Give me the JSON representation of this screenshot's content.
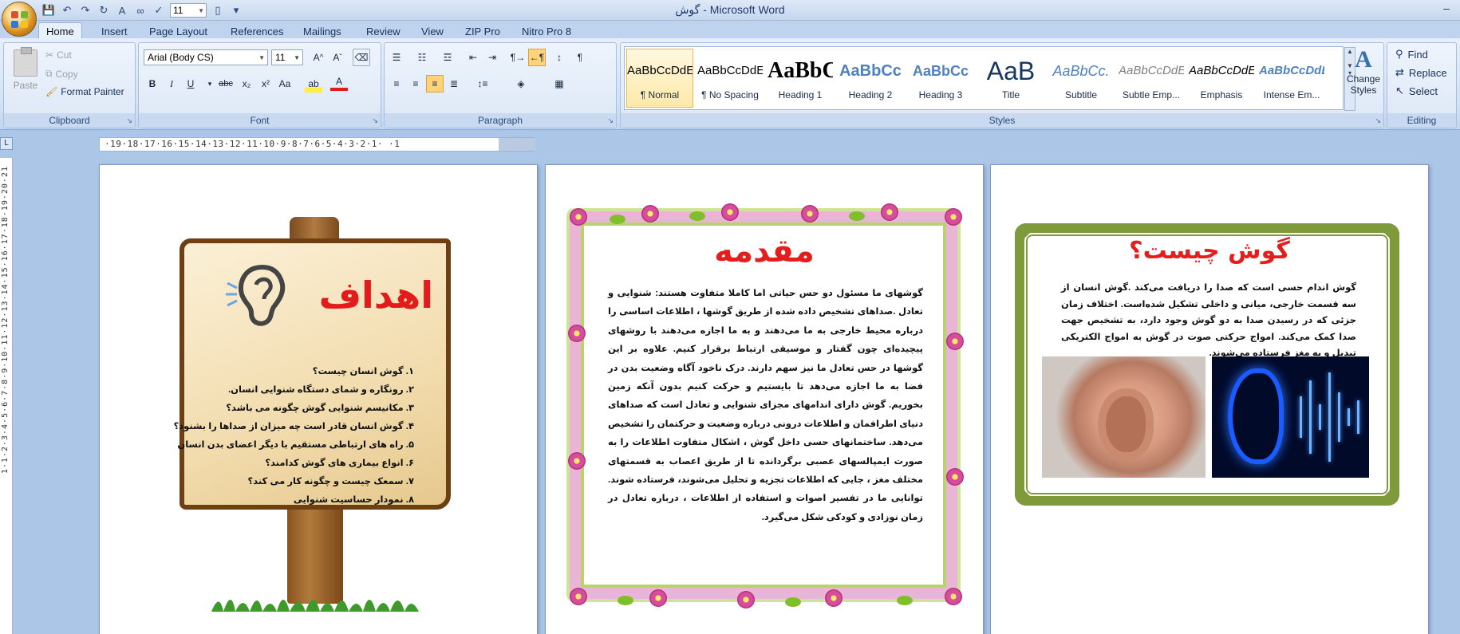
{
  "window": {
    "title": "گوش - Microsoft Word",
    "qat_font_size": "11"
  },
  "tabs": [
    "Home",
    "Insert",
    "Page Layout",
    "References",
    "Mailings",
    "Review",
    "View",
    "ZIP Pro",
    "Nitro Pro 8"
  ],
  "clipboard": {
    "label": "Clipboard",
    "paste": "Paste",
    "cut": "Cut",
    "copy": "Copy",
    "format_painter": "Format Painter"
  },
  "font": {
    "label": "Font",
    "name": "Arial (Body CS)",
    "size": "11"
  },
  "paragraph": {
    "label": "Paragraph"
  },
  "styles": {
    "label": "Styles",
    "items": [
      {
        "preview": "AaBbCcDdEe",
        "name": "¶ Normal"
      },
      {
        "preview": "AaBbCcDdEe",
        "name": "¶ No Spacing"
      },
      {
        "preview": "AaBbCc",
        "name": "Heading 1"
      },
      {
        "preview": "AaBbCc",
        "name": "Heading 2"
      },
      {
        "preview": "AaBbCc",
        "name": "Heading 3"
      },
      {
        "preview": "AaB",
        "name": "Title"
      },
      {
        "preview": "AaBbCc.",
        "name": "Subtitle"
      },
      {
        "preview": "AaBbCcDdEe",
        "name": "Subtle Emp..."
      },
      {
        "preview": "AaBbCcDdEe",
        "name": "Emphasis"
      },
      {
        "preview": "AaBbCcDdEe",
        "name": "Intense Em..."
      }
    ],
    "change_styles": "Change Styles"
  },
  "editing": {
    "label": "Editing",
    "find": "Find",
    "replace": "Replace",
    "select": "Select"
  },
  "ruler": {
    "h_numbers": "·19·18·17·16·15·14·13·12·11·10·9·8·7·6·5·4·3·2·1·  ·1",
    "v_numbers": "1·1·2·3·4·5·6·7·8·9·10·11·12·13·14·15·16·17·18·19·20·21"
  },
  "page_left": {
    "title": "اهداف",
    "items": [
      "۱.  گوش انسان چیست؟",
      "۲.  رونگاره و شمای دستگاه شنوایی انسان.",
      "۳.  مکانیسم شنوایی گوش چگونه می باشد؟",
      "۴.  گوش انسان قادر است چه میزان از صداها را بشنود؟",
      "۵.  راه های ارتباطی مستقیم با دیگر اعضای بدن انسان",
      "۶.  انواع بیماری های گوش کدامند؟",
      "۷.  سمعک چیست و چگونه کار می کند؟",
      "۸.  نمودار حساسیت شنوایی"
    ]
  },
  "page_middle": {
    "title": "مقدمه",
    "body": "گوشهای ما مسئول دو حس حیاتی اما کاملا متفاوت هستند: شنوایی و تعادل .صداهای تشخیص داده شده از طریق گوشها ، اطلاعات اساسی را درباره محیط خارجی به ما می‌دهند و به ما اجازه می‌دهند با روشهای پیچیده‌ای چون گفتار و موسیقی ارتباط برقرار کنیم. علاوه بر این گوشها در حس تعادل ما نیز سهم دارند. درک ناخود آگاه وضعیت بدن در فضا به ما اجازه می‌دهد تا بایستیم و حرکت کنیم بدون آنکه زمین بخوریم. گوش دارای اندامهای مجزای شنوایی و تعادل است که صداهای دنیای اطرافمان و اطلاعات درونی درباره وضعیت و حرکتمان را تشخیص می‌دهد. ساختمانهای حسی داخل گوش ، اشکال متفاوت اطلاعات را به صورت ایمپالسهای عصبی برگردانده تا از طریق اعصاب به قسمتهای مختلف مغز ، جایی که اطلاعات تجزیه و تحلیل می‌شوند، فرستاده شوند. توانایی ما در تفسیر اصوات و استفاده از اطلاعات ، درباره تعادل در زمان نوزادی و کودکی شکل می‌گیرد."
  },
  "page_right": {
    "title": "گوش چیست؟",
    "body": "گوش اندام حسی است که صدا را دریافت می‌کند .گوش انسان از سه قسمت خارجی، میانی و داخلی تشکیل شده‌است. اختلاف زمان جزئی که در رسیدن صدا به دو گوش وجود دارد، به تشخیص جهت صدا کمک می‌کند. امواج حرکتی صوت در گوش به امواج الکتریکی تبدیل و به مغز فرستاده می‌شوند."
  }
}
